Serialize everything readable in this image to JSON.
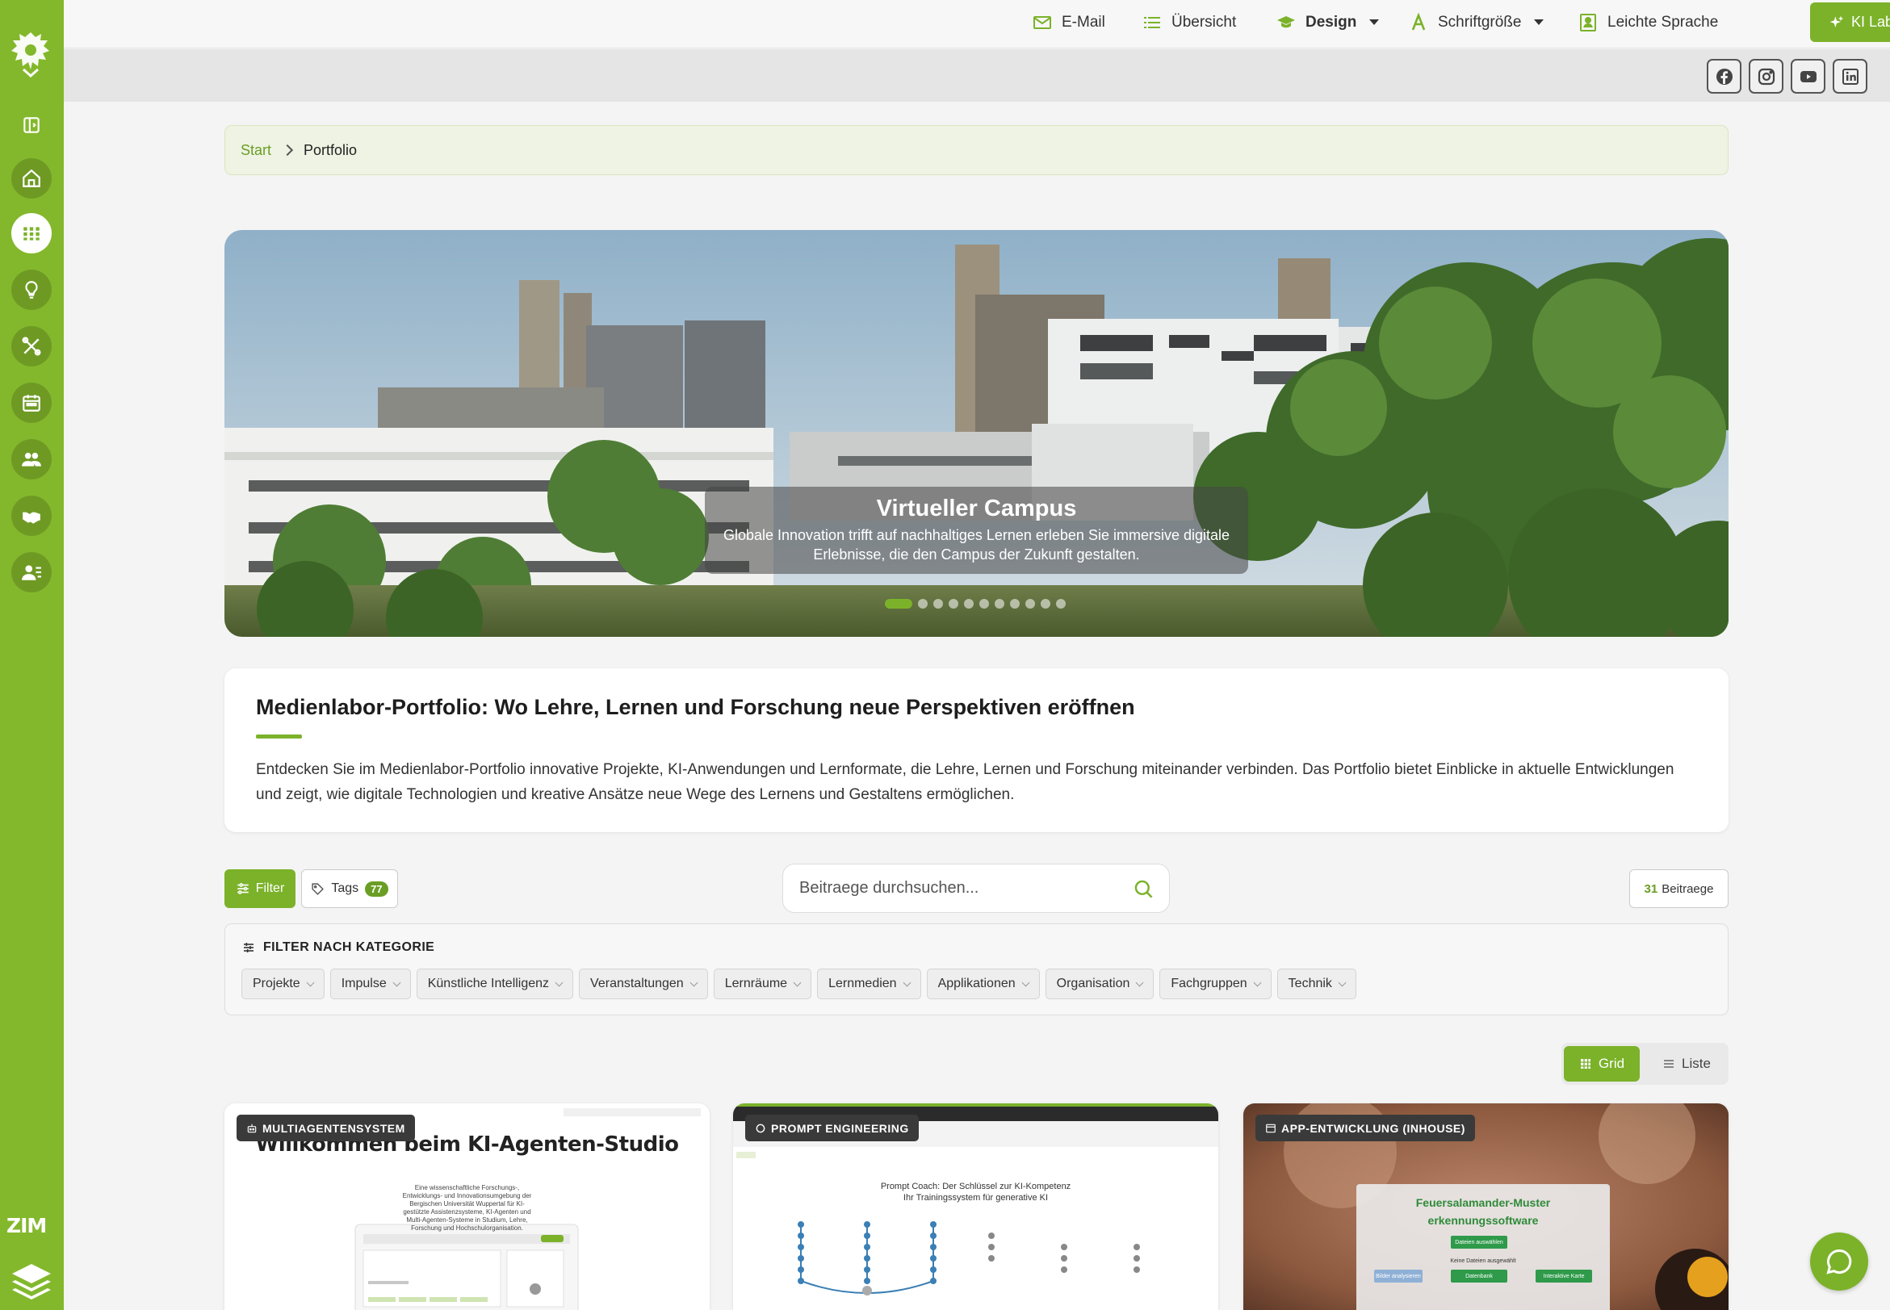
{
  "topnav": {
    "email": "E-Mail",
    "uebersicht": "Übersicht",
    "design": "Design",
    "schriftgroesse": "Schriftgröße",
    "leichte_sprache": "Leichte Sprache",
    "ki_labor": "KI Labor"
  },
  "social": [
    "facebook-icon",
    "instagram-icon",
    "youtube-icon",
    "linkedin-icon"
  ],
  "sidebar": {
    "items": [
      "sidebar-toggle",
      "home",
      "portfolio",
      "ideas",
      "tools",
      "calendar",
      "team",
      "partners",
      "contacts"
    ],
    "active": "portfolio",
    "brand": "ZIM"
  },
  "breadcrumb": {
    "start": "Start",
    "current": "Portfolio"
  },
  "hero": {
    "title": "Virtueller Campus",
    "text": "Globale Innovation trifft auf nachhaltiges Lernen erleben Sie immersive digitale Erlebnisse, die den Campus der Zukunft gestalten.",
    "slides": 11,
    "active_slide": 1
  },
  "intro": {
    "title": "Medienlabor-Portfolio: Wo Lehre, Lernen und Forschung neue Perspektiven eröffnen",
    "text": "Entdecken Sie im Medienlabor-Portfolio innovative Projekte, KI-Anwendungen und Lernformate, die Lehre, Lernen und Forschung miteinander verbinden. Das Portfolio bietet Einblicke in aktuelle Entwicklungen und zeigt, wie digitale Technologien und kreative Ansätze neue Wege des Lernens und Gestaltens ermöglichen."
  },
  "toolbar": {
    "filter": "Filter",
    "tags": "Tags",
    "tags_count": "77",
    "search_placeholder": "Beitraege durchsuchen...",
    "count_number": "31",
    "count_label": "Beitraege"
  },
  "categories": {
    "title": "FILTER NACH KATEGORIE",
    "items": [
      "Projekte",
      "Impulse",
      "Künstliche Intelligenz",
      "Veranstaltungen",
      "Lernräume",
      "Lernmedien",
      "Applikationen",
      "Organisation",
      "Fachgruppen",
      "Technik"
    ]
  },
  "view": {
    "grid": "Grid",
    "liste": "Liste",
    "active": "grid"
  },
  "cards": [
    {
      "tag": "MULTIAGENTENSYSTEM",
      "heading": "Willkommen beim KI-Agenten-Studio",
      "sub": "Eine wissenschaftliche Forschungs-, Entwicklungs- und Innovationsumgebung der Bergischen Universität Wuppertal für KI-gestützte Assistenzsysteme, KI-Agenten und Multi-Agenten-Systeme in Studium, Lehre, Forschung und Hochschulorganisation."
    },
    {
      "tag": "PROMPT ENGINEERING",
      "heading": "Prompt Coach: Der Schlüssel zur KI-Kompetenz",
      "sub": "Ihr Trainingssystem für generative KI"
    },
    {
      "tag": "APP-ENTWICKLUNG (INHOUSE)",
      "heading": "Feuersalamander-Mustererkennungssoftware",
      "button1": "Dateien auswählen",
      "note": "Keine Dateien ausgewählt",
      "button2": "Bilder analysieren",
      "button3": "Datenbank",
      "button4": "Interaktive Karte"
    }
  ],
  "colors": {
    "accent": "#7bb22a",
    "sidebar": "#83b82c",
    "tag_bg": "#3a3a3a"
  }
}
